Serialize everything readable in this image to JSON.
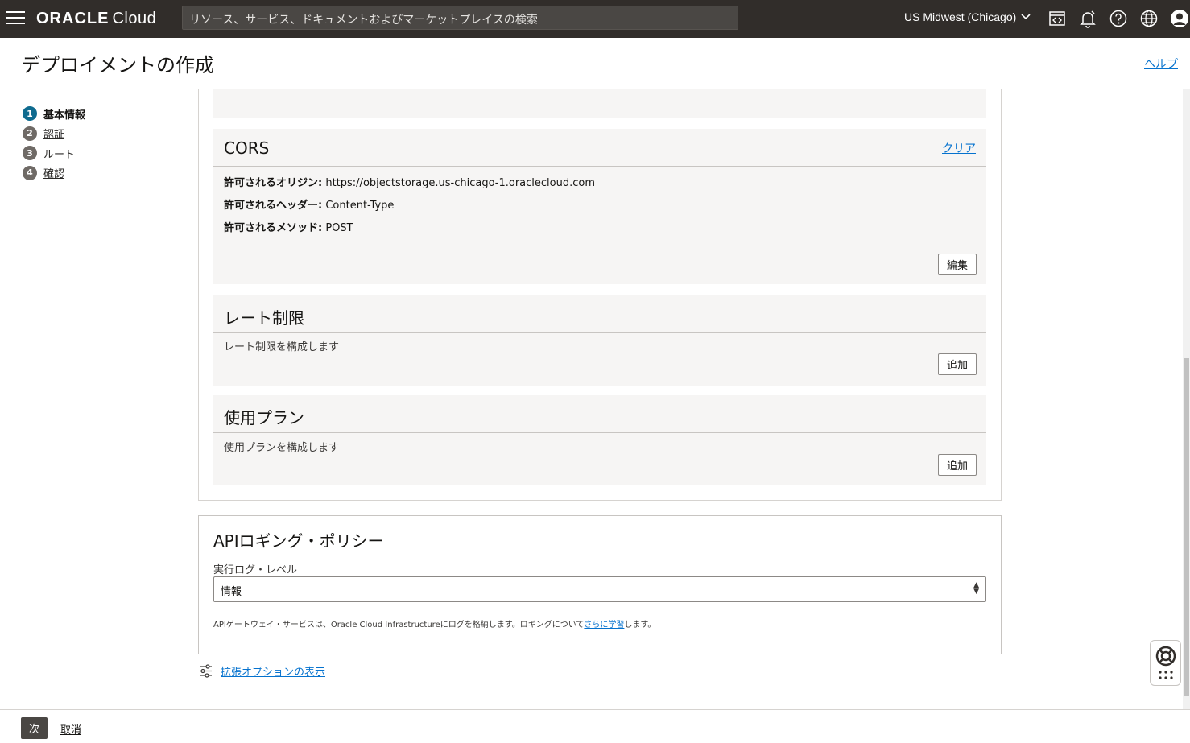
{
  "topbar": {
    "logo_main": "ORACLE",
    "logo_sub": "Cloud",
    "search_placeholder": "リソース、サービス、ドキュメントおよびマーケットプレイスの検索",
    "region": "US Midwest (Chicago)",
    "icons": [
      "menu-icon",
      "code-editor-icon",
      "bell-icon",
      "help-circle-icon",
      "globe-icon",
      "user-avatar-icon"
    ]
  },
  "header": {
    "title": "デプロイメントの作成",
    "help": "ヘルプ"
  },
  "steps": [
    {
      "num": "1",
      "label": "基本情報"
    },
    {
      "num": "2",
      "label": "認証"
    },
    {
      "num": "3",
      "label": "ルート"
    },
    {
      "num": "4",
      "label": "確認"
    }
  ],
  "cors": {
    "title": "CORS",
    "clear": "クリア",
    "origin_key": "許可されるオリジン:",
    "origin_val": "https://objectstorage.us-chicago-1.oraclecloud.com",
    "headers_key": "許可されるヘッダー:",
    "headers_val": "Content-Type",
    "methods_key": "許可されるメソッド:",
    "methods_val": "POST",
    "edit": "編集"
  },
  "rate_limit": {
    "title": "レート制限",
    "desc": "レート制限を構成します",
    "add": "追加"
  },
  "usage_plan": {
    "title": "使用プラン",
    "desc": "使用プランを構成します",
    "add": "追加"
  },
  "logging": {
    "title": "APIロギング・ポリシー",
    "level_label": "実行ログ・レベル",
    "level_value": "情報",
    "note_prefix": "APIゲートウェイ・サービスは、Oracle Cloud Infrastructureにログを格納します。ロギングについて",
    "note_link": "さらに学習",
    "note_suffix": "します。"
  },
  "advanced": "拡張オプションの表示",
  "footer": {
    "next": "次",
    "cancel": "取消"
  }
}
